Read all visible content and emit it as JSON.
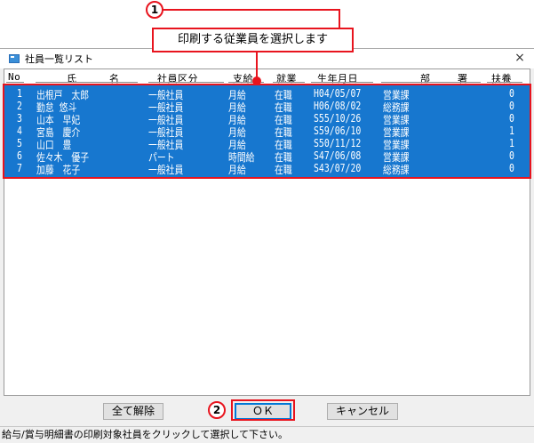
{
  "window": {
    "title": "社員一覧リスト",
    "close_glyph": "×"
  },
  "columns": {
    "no": "No",
    "name_1": "氏",
    "name_2": "名",
    "employee_class": "社員区分",
    "pay": "支給",
    "status": "就業",
    "birthdate": "生年月日",
    "dept_1": "部",
    "dept_2": "署",
    "dependents": "扶養"
  },
  "employees": [
    {
      "no": "1",
      "name": "出根戸　太郎",
      "class": "一般社員",
      "pay": "月給",
      "status": "在職",
      "birth": "H04/05/07",
      "dept": "営業課",
      "dependents": "0"
    },
    {
      "no": "2",
      "name": "勤怠 悠斗",
      "class": "一般社員",
      "pay": "月給",
      "status": "在職",
      "birth": "H06/08/02",
      "dept": "総務課",
      "dependents": "0"
    },
    {
      "no": "3",
      "name": "山本　早妃",
      "class": "一般社員",
      "pay": "月給",
      "status": "在職",
      "birth": "S55/10/26",
      "dept": "営業課",
      "dependents": "0"
    },
    {
      "no": "4",
      "name": "宮島　慶介",
      "class": "一般社員",
      "pay": "月給",
      "status": "在職",
      "birth": "S59/06/10",
      "dept": "営業課",
      "dependents": "1"
    },
    {
      "no": "5",
      "name": "山口　豊",
      "class": "一般社員",
      "pay": "月給",
      "status": "在職",
      "birth": "S50/11/12",
      "dept": "営業課",
      "dependents": "1"
    },
    {
      "no": "6",
      "name": "佐々木　優子",
      "class": "パート",
      "pay": "時間給",
      "status": "在職",
      "birth": "S47/06/08",
      "dept": "営業課",
      "dependents": "0"
    },
    {
      "no": "7",
      "name": "加藤　花子",
      "class": "一般社員",
      "pay": "月給",
      "status": "在職",
      "birth": "S43/07/20",
      "dept": "総務課",
      "dependents": "0"
    }
  ],
  "buttons": {
    "clear_all": "全て解除",
    "ok": "ＯＫ",
    "cancel": "キャンセル"
  },
  "status_text": "給与/賞与明細書の印刷対象社員をクリックして選択して下さい。",
  "annotations": {
    "step1_badge": "1",
    "step1_text": "印刷する従業員を選択します",
    "step2_badge": "2",
    "accent_color": "#e8141e"
  },
  "colors": {
    "selection": "#1777cf",
    "window_bg": "#f0f0f0"
  }
}
